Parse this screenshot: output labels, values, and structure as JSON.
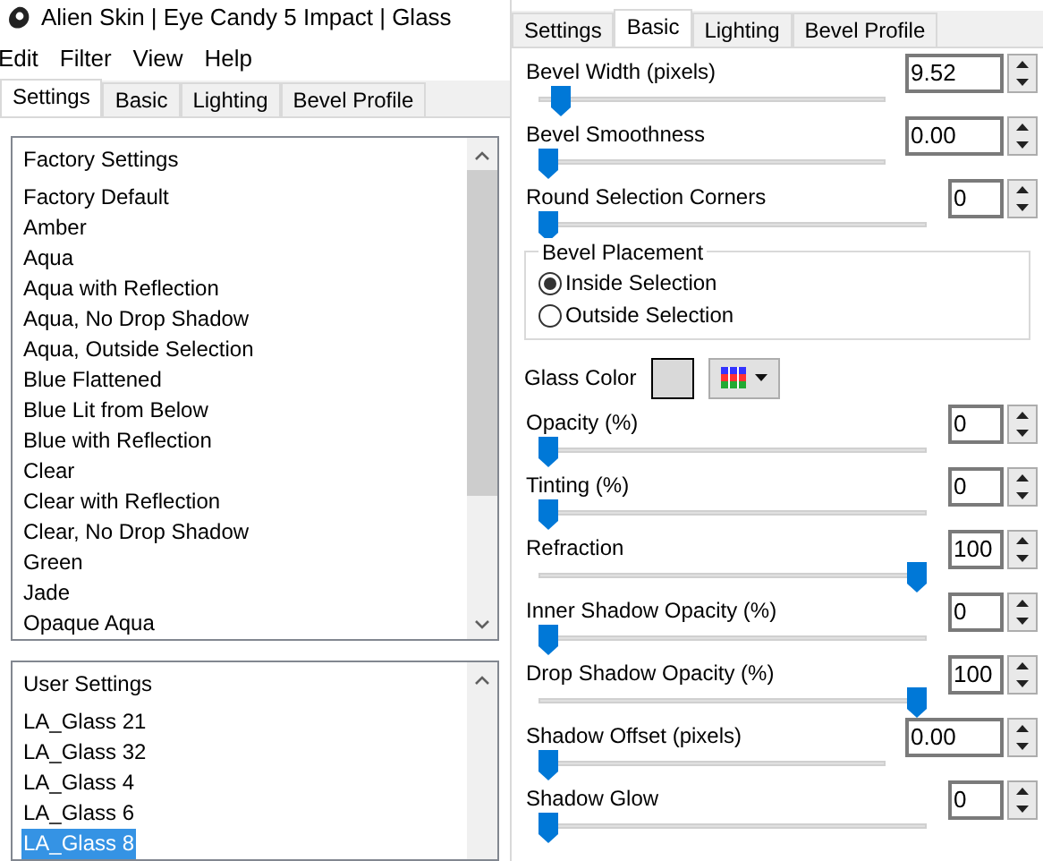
{
  "window": {
    "title": "Alien Skin | Eye Candy 5 Impact | Glass"
  },
  "menu": [
    "Edit",
    "Filter",
    "View",
    "Help"
  ],
  "left_tabs": [
    {
      "label": "Settings",
      "selected": true
    },
    {
      "label": "Basic",
      "selected": false
    },
    {
      "label": "Lighting",
      "selected": false
    },
    {
      "label": "Bevel Profile",
      "selected": false
    }
  ],
  "factory_settings": {
    "header": "Factory Settings",
    "items": [
      {
        "label": "Factory Default",
        "selected": false
      },
      {
        "label": "Amber",
        "selected": false
      },
      {
        "label": "Aqua",
        "selected": false
      },
      {
        "label": "Aqua with Reflection",
        "selected": false
      },
      {
        "label": "Aqua, No Drop Shadow",
        "selected": false
      },
      {
        "label": "Aqua, Outside Selection",
        "selected": false
      },
      {
        "label": "Blue Flattened",
        "selected": false
      },
      {
        "label": "Blue Lit from Below",
        "selected": false
      },
      {
        "label": "Blue with Reflection",
        "selected": false
      },
      {
        "label": "Clear",
        "selected": false
      },
      {
        "label": "Clear with Reflection",
        "selected": false
      },
      {
        "label": "Clear, No Drop Shadow",
        "selected": false
      },
      {
        "label": "Green",
        "selected": false
      },
      {
        "label": "Jade",
        "selected": false
      },
      {
        "label": "Opaque Aqua",
        "selected": false
      }
    ]
  },
  "user_settings": {
    "header": "User Settings",
    "items": [
      {
        "label": "LA_Glass 21",
        "selected": false
      },
      {
        "label": "LA_Glass 32",
        "selected": false
      },
      {
        "label": "LA_Glass 4",
        "selected": false
      },
      {
        "label": "LA_Glass 6",
        "selected": false
      },
      {
        "label": "LA_Glass 8",
        "selected": true
      }
    ]
  },
  "right_tabs": [
    {
      "label": "Settings",
      "selected": false
    },
    {
      "label": "Basic",
      "selected": true
    },
    {
      "label": "Lighting",
      "selected": false
    },
    {
      "label": "Bevel Profile",
      "selected": false
    }
  ],
  "controls_top": [
    {
      "label": "Bevel Width (pixels)",
      "value": "9.52",
      "kind": "decimal",
      "level": 0.04
    },
    {
      "label": "Bevel Smoothness",
      "value": "0.00",
      "kind": "decimal",
      "level": 0
    },
    {
      "label": "Round Selection Corners",
      "value": "0",
      "kind": "integer",
      "level": 0
    }
  ],
  "bevel_placement": {
    "title": "Bevel Placement",
    "options": [
      {
        "label": "Inside Selection",
        "selected": true
      },
      {
        "label": "Outside Selection",
        "selected": false
      }
    ]
  },
  "glass_color": {
    "label": "Glass Color"
  },
  "controls_bottom": [
    {
      "label": "Opacity (%)",
      "value": "0",
      "kind": "integer",
      "level": 0
    },
    {
      "label": "Tinting (%)",
      "value": "0",
      "kind": "integer",
      "level": 0
    },
    {
      "label": "Refraction",
      "value": "100",
      "kind": "integer",
      "level": 1
    },
    {
      "label": "Inner Shadow Opacity (%)",
      "value": "0",
      "kind": "integer",
      "level": 0
    },
    {
      "label": "Drop Shadow Opacity (%)",
      "value": "100",
      "kind": "integer",
      "level": 1
    },
    {
      "label": "Shadow Offset (pixels)",
      "value": "0.00",
      "kind": "decimal",
      "level": 0
    },
    {
      "label": "Shadow Glow",
      "value": "0",
      "kind": "integer",
      "level": 0
    }
  ]
}
